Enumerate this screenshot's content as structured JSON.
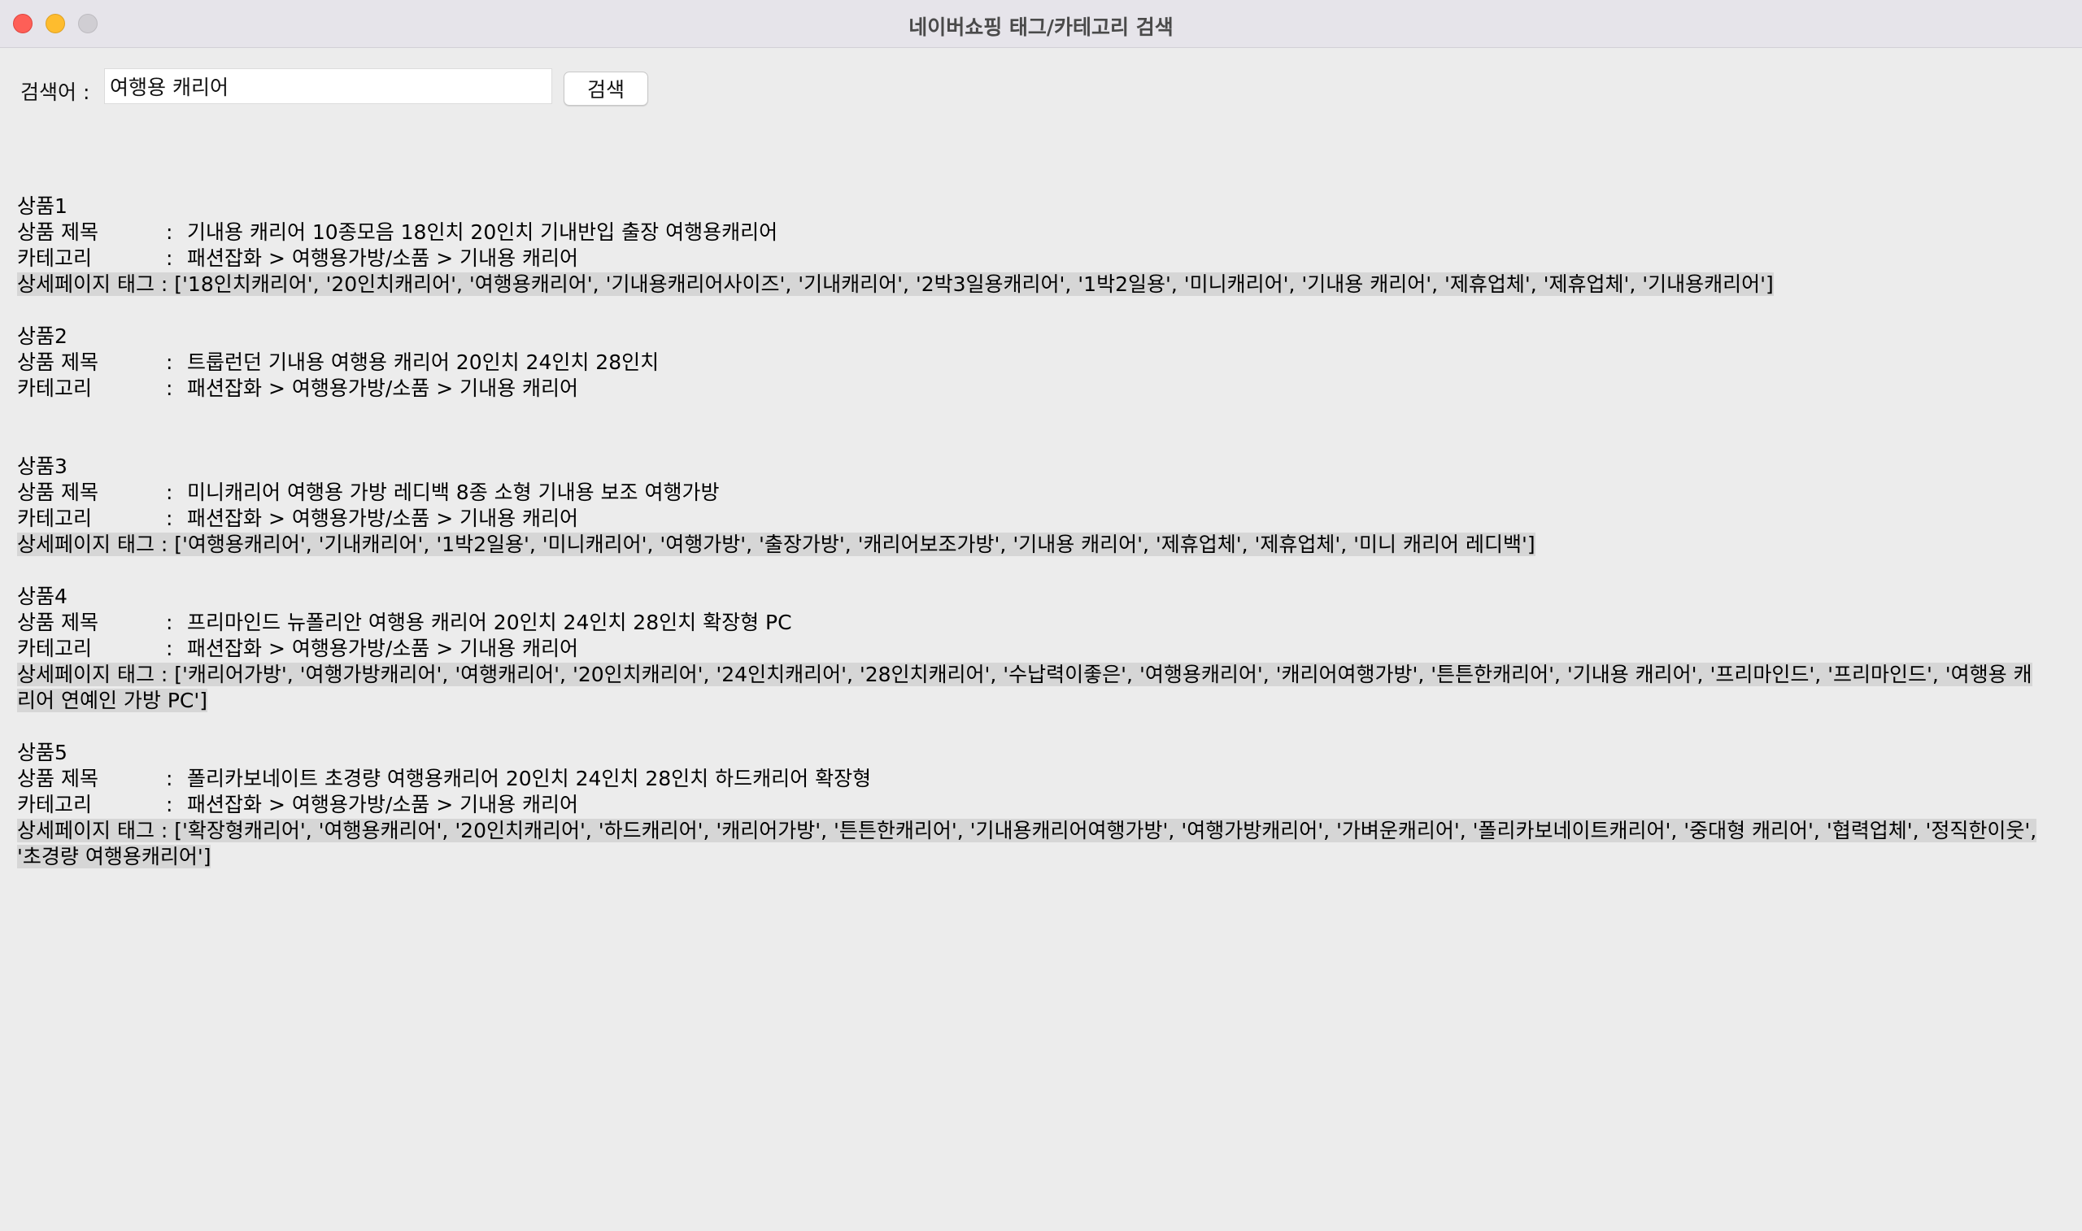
{
  "window": {
    "title": "네이버쇼핑 태그/카테고리 검색"
  },
  "search": {
    "label": "검색어 :",
    "value": "여행용 캐리어",
    "button_label": "검색"
  },
  "field_labels": {
    "title": "상품 제목",
    "category": "카테고리",
    "tags": "상세페이지 태그 :",
    "separator": ":"
  },
  "products": [
    {
      "heading": "상품1",
      "title": "기내용 캐리어 10종모음 18인치 20인치 기내반입 출장 여행용캐리어",
      "category": "패션잡화 > 여행용가방/소품 > 기내용 캐리어",
      "tags": "['18인치캐리어', '20인치캐리어', '여행용캐리어', '기내용캐리어사이즈', '기내캐리어', '2박3일용캐리어', '1박2일용', '미니캐리어', '기내용 캐리어', '제휴업체', '제휴업체', '기내용캐리어']"
    },
    {
      "heading": "상품2",
      "title": "트룹런던 기내용 여행용 캐리어 20인치 24인치 28인치",
      "category": "패션잡화 > 여행용가방/소품 > 기내용 캐리어",
      "tags": ""
    },
    {
      "heading": "상품3",
      "title": "미니캐리어 여행용 가방 레디백 8종 소형 기내용 보조 여행가방",
      "category": "패션잡화 > 여행용가방/소품 > 기내용 캐리어",
      "tags": "['여행용캐리어', '기내캐리어', '1박2일용', '미니캐리어', '여행가방', '출장가방', '캐리어보조가방', '기내용 캐리어', '제휴업체', '제휴업체', '미니 캐리어 레디백']"
    },
    {
      "heading": "상품4",
      "title": "프리마인드 뉴폴리안 여행용 캐리어 20인치 24인치 28인치 확장형 PC",
      "category": "패션잡화 > 여행용가방/소품 > 기내용 캐리어",
      "tags": "['캐리어가방', '여행가방캐리어', '여행캐리어', '20인치캐리어', '24인치캐리어', '28인치캐리어', '수납력이좋은', '여행용캐리어', '캐리어여행가방', '튼튼한캐리어', '기내용 캐리어', '프리마인드', '프리마인드', '여행용 캐리어 연예인 가방 PC']"
    },
    {
      "heading": "상품5",
      "title": "폴리카보네이트 초경량 여행용캐리어 20인치 24인치 28인치 하드캐리어 확장형",
      "category": "패션잡화 > 여행용가방/소품 > 기내용 캐리어",
      "tags": "['확장형캐리어', '여행용캐리어', '20인치캐리어', '하드캐리어', '캐리어가방', '튼튼한캐리어', '기내용캐리어여행가방', '여행가방캐리어', '가벼운캐리어', '폴리카보네이트캐리어', '중대형 캐리어', '협력업체', '정직한이웃', '초경량 여행용캐리어']"
    }
  ]
}
